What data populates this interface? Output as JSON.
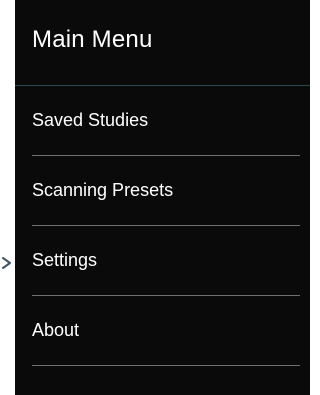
{
  "menu": {
    "title": "Main Menu",
    "items": [
      {
        "label": "Saved Studies"
      },
      {
        "label": "Scanning Presets"
      },
      {
        "label": "Settings"
      },
      {
        "label": "About"
      }
    ]
  },
  "colors": {
    "panel_background": "#0a0a0a",
    "text": "#ffffff",
    "header_divider": "#2a4a50",
    "item_divider": "#6f6f6f",
    "pointer_arrow": "#3d5566"
  },
  "icons": {
    "pointer": "chevron-right-icon"
  }
}
